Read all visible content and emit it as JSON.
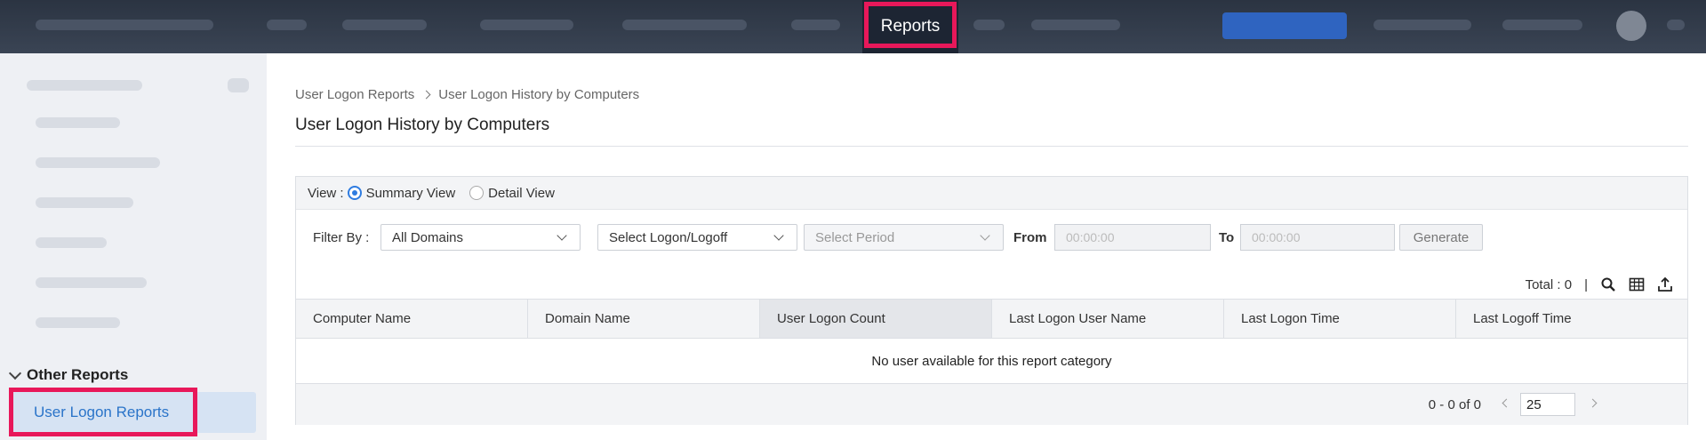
{
  "topnav": {
    "active_tab": "Reports"
  },
  "sidebar": {
    "section_label": "Other Reports",
    "active_item": "User Logon Reports"
  },
  "breadcrumb": {
    "parent": "User Logon Reports",
    "current": "User Logon History by Computers"
  },
  "page": {
    "title": "User Logon History by Computers"
  },
  "view": {
    "label": "View :",
    "options": [
      "Summary View",
      "Detail View"
    ],
    "selected": "Summary View"
  },
  "filters": {
    "filter_by_label": "Filter By :",
    "domain_value": "All Domains",
    "logon_value": "Select Logon/Logoff",
    "period_placeholder": "Select Period",
    "from_label": "From",
    "from_placeholder": "00:00:00",
    "to_label": "To",
    "to_placeholder": "00:00:00",
    "generate_label": "Generate"
  },
  "table": {
    "total_label": "Total : 0",
    "columns": [
      "Computer Name",
      "Domain Name",
      "User Logon Count",
      "Last Logon User Name",
      "Last Logon Time",
      "Last Logoff Time"
    ],
    "empty_message": "No user available for this report category"
  },
  "pagination": {
    "range": "0 - 0 of 0",
    "page_size": "25"
  },
  "colors": {
    "highlight": "#e8185a",
    "accent": "#2f7ce0",
    "topbar": "#2b3442"
  }
}
